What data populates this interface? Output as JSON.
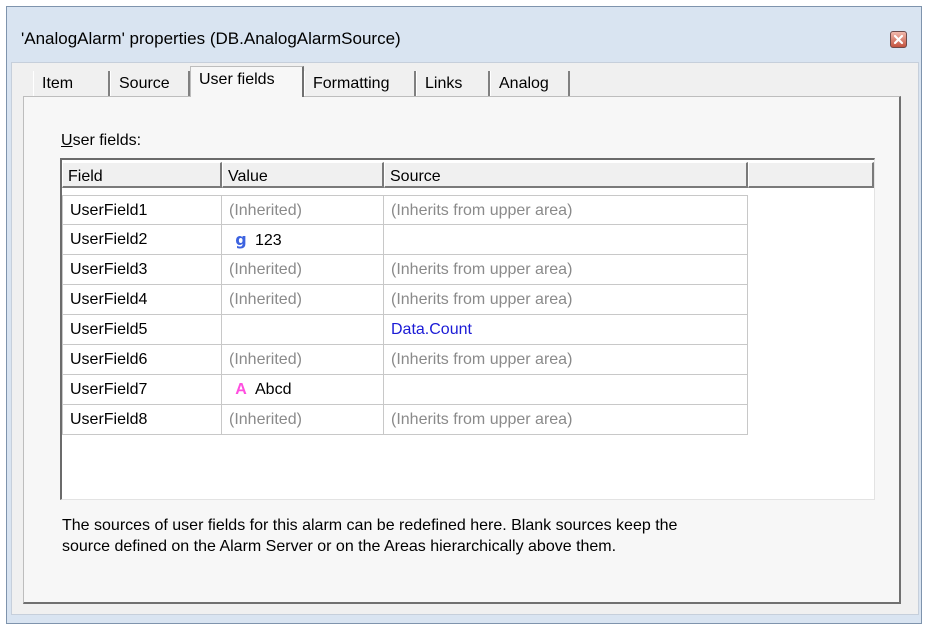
{
  "window": {
    "title": "'AnalogAlarm' properties (DB.AnalogAlarmSource)"
  },
  "tabs": [
    {
      "label": "Item",
      "active": false
    },
    {
      "label": "Source",
      "active": false
    },
    {
      "label": "User fields",
      "active": true
    },
    {
      "label": "Formatting",
      "active": false
    },
    {
      "label": "Links",
      "active": false
    },
    {
      "label": "Analog",
      "active": false
    }
  ],
  "user_fields": {
    "group_label_accel": "U",
    "group_label_rest": "ser fields:",
    "columns": [
      "Field",
      "Value",
      "Source"
    ],
    "rows": [
      {
        "field": "UserField1",
        "value": "(Inherited)",
        "value_icon": "",
        "source": "(Inherits from upper area)"
      },
      {
        "field": "UserField2",
        "value": "123",
        "value_icon": "g",
        "source": ""
      },
      {
        "field": "UserField3",
        "value": "(Inherited)",
        "value_icon": "",
        "source": "(Inherits from upper area)"
      },
      {
        "field": "UserField4",
        "value": "(Inherited)",
        "value_icon": "",
        "source": "(Inherits from upper area)"
      },
      {
        "field": "UserField5",
        "value": "",
        "value_icon": "",
        "source": "Data.Count"
      },
      {
        "field": "UserField6",
        "value": "(Inherited)",
        "value_icon": "",
        "source": "(Inherits from upper area)"
      },
      {
        "field": "UserField7",
        "value": "Abcd",
        "value_icon": "A",
        "source": ""
      },
      {
        "field": "UserField8",
        "value": "(Inherited)",
        "value_icon": "",
        "source": "(Inherits from upper area)"
      }
    ]
  },
  "description": [
    "The sources of user fields for this alarm can be redefined here. Blank sources keep the",
    "source defined on the Alarm Server or on the Areas hierarchically above them."
  ],
  "colors": {
    "title_bar": "#d9e4f1",
    "inherited_text": "#8a8a8a",
    "source_link": "#1b1bd6",
    "numeric_icon": "#3d63e0",
    "text_icon": "#ff4fe0",
    "close_button": "#c4533f"
  },
  "icons": {
    "close": "close-icon",
    "numeric_value": "numeric-value-icon",
    "text_value": "text-value-icon"
  }
}
